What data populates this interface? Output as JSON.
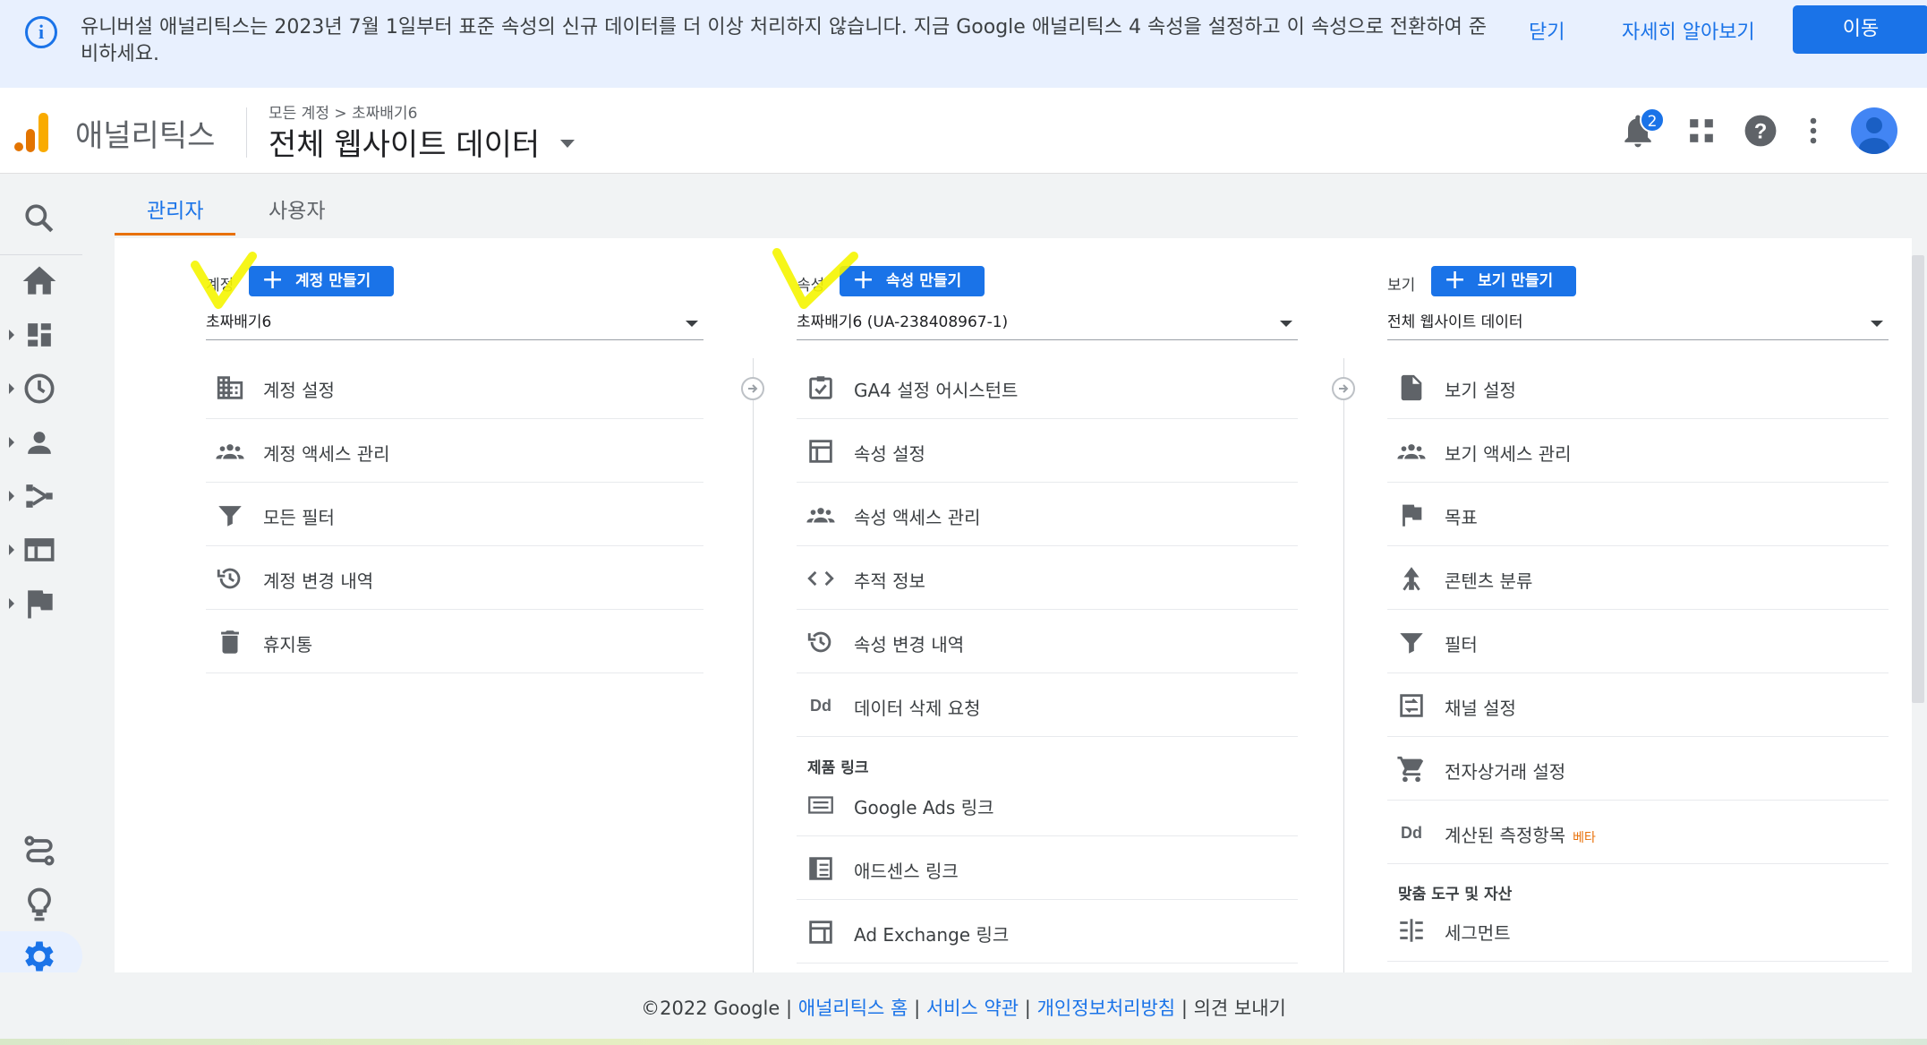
{
  "banner": {
    "text": "유니버설 애널리틱스는 2023년 7월 1일부터 표준 속성의 신규 데이터를 더 이상 처리하지 않습니다. 지금 Google 애널리틱스 4 속성을 설정하고 이 속성으로 전환하여 준비하세요.",
    "dismiss_label": "닫기",
    "learn_more_label": "자세히 알아보기",
    "go_label": "이동"
  },
  "header": {
    "app_name": "애널리틱스",
    "breadcrumb": "모든 계정 > 초짜배기6",
    "view_title": "전체 웹사이트 데이터",
    "notification_count": "2"
  },
  "tabs": [
    {
      "label": "관리자",
      "active": true
    },
    {
      "label": "사용자",
      "active": false
    }
  ],
  "columns": {
    "account": {
      "label": "계정",
      "create_label": "계정 만들기",
      "selected": "초짜배기6",
      "items": [
        {
          "label": "계정 설정",
          "icon": "building-icon"
        },
        {
          "label": "계정 액세스 관리",
          "icon": "people-icon"
        },
        {
          "label": "모든 필터",
          "icon": "filter-icon"
        },
        {
          "label": "계정 변경 내역",
          "icon": "history-icon"
        },
        {
          "label": "휴지통",
          "icon": "trash-icon"
        }
      ]
    },
    "property": {
      "label": "속성",
      "create_label": "속성 만들기",
      "selected": "초짜배기6 (UA-238408967-1)",
      "items": [
        {
          "label": "GA4 설정 어시스턴트",
          "icon": "checkbox-icon"
        },
        {
          "label": "속성 설정",
          "icon": "layout-icon"
        },
        {
          "label": "속성 액세스 관리",
          "icon": "people-icon"
        },
        {
          "label": "추적 정보",
          "icon": "code-icon"
        },
        {
          "label": "속성 변경 내역",
          "icon": "history-icon"
        },
        {
          "label": "데이터 삭제 요청",
          "icon": "dd-icon"
        }
      ],
      "links_section": "제품 링크",
      "links": [
        {
          "label": "Google Ads 링크",
          "icon": "ads-icon"
        },
        {
          "label": "애드센스 링크",
          "icon": "adsense-icon"
        },
        {
          "label": "Ad Exchange 링크",
          "icon": "adexchange-icon"
        }
      ]
    },
    "view": {
      "label": "보기",
      "create_label": "보기 만들기",
      "selected": "전체 웹사이트 데이터",
      "items": [
        {
          "label": "보기 설정",
          "icon": "document-icon"
        },
        {
          "label": "보기 액세스 관리",
          "icon": "people-icon"
        },
        {
          "label": "목표",
          "icon": "flag-icon"
        },
        {
          "label": "콘텐츠 분류",
          "icon": "content-icon"
        },
        {
          "label": "필터",
          "icon": "filter-icon"
        },
        {
          "label": "채널 설정",
          "icon": "channel-icon"
        },
        {
          "label": "전자상거래 설정",
          "icon": "cart-icon"
        },
        {
          "label": "계산된 측정항목",
          "icon": "dd-icon",
          "badge": "베타"
        }
      ],
      "tools_section": "맞춤 도구 및 자산",
      "tools": [
        {
          "label": "세그먼트",
          "icon": "segment-icon"
        }
      ]
    }
  },
  "footer": {
    "copyright": "©2022 Google",
    "sep": "|",
    "home": "애널리틱스 홈",
    "terms": "서비스 약관",
    "privacy": "개인정보처리방침",
    "feedback": "의견 보내기"
  },
  "colors": {
    "accent": "#1a73e8",
    "tab_underline": "#e8710a",
    "highlight": "#f5f500"
  }
}
